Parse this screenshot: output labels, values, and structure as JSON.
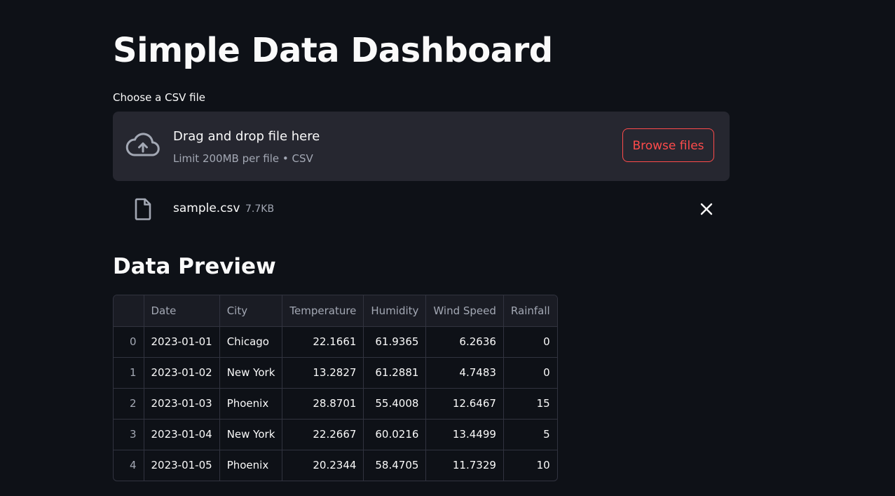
{
  "page": {
    "title": "Simple Data Dashboard"
  },
  "uploader": {
    "label": "Choose a CSV file",
    "drop_title": "Drag and drop file here",
    "drop_subtitle": "Limit 200MB per file • CSV",
    "browse_label": "Browse files",
    "icon": "cloud-upload-icon",
    "accent_color": "#ff4b4b"
  },
  "uploaded_file": {
    "name": "sample.csv",
    "size": "7.7KB",
    "icon": "file-icon",
    "remove_icon": "close-icon"
  },
  "preview": {
    "title": "Data Preview",
    "columns": [
      "",
      "Date",
      "City",
      "Temperature",
      "Humidity",
      "Wind Speed",
      "Rainfall"
    ],
    "rows": [
      [
        "0",
        "2023-01-01",
        "Chicago",
        "22.1661",
        "61.9365",
        "6.2636",
        "0"
      ],
      [
        "1",
        "2023-01-02",
        "New York",
        "13.2827",
        "61.2881",
        "4.7483",
        "0"
      ],
      [
        "2",
        "2023-01-03",
        "Phoenix",
        "28.8701",
        "55.4008",
        "12.6467",
        "15"
      ],
      [
        "3",
        "2023-01-04",
        "New York",
        "22.2667",
        "60.0216",
        "13.4499",
        "5"
      ],
      [
        "4",
        "2023-01-05",
        "Phoenix",
        "20.2344",
        "58.4705",
        "11.7329",
        "10"
      ]
    ]
  }
}
